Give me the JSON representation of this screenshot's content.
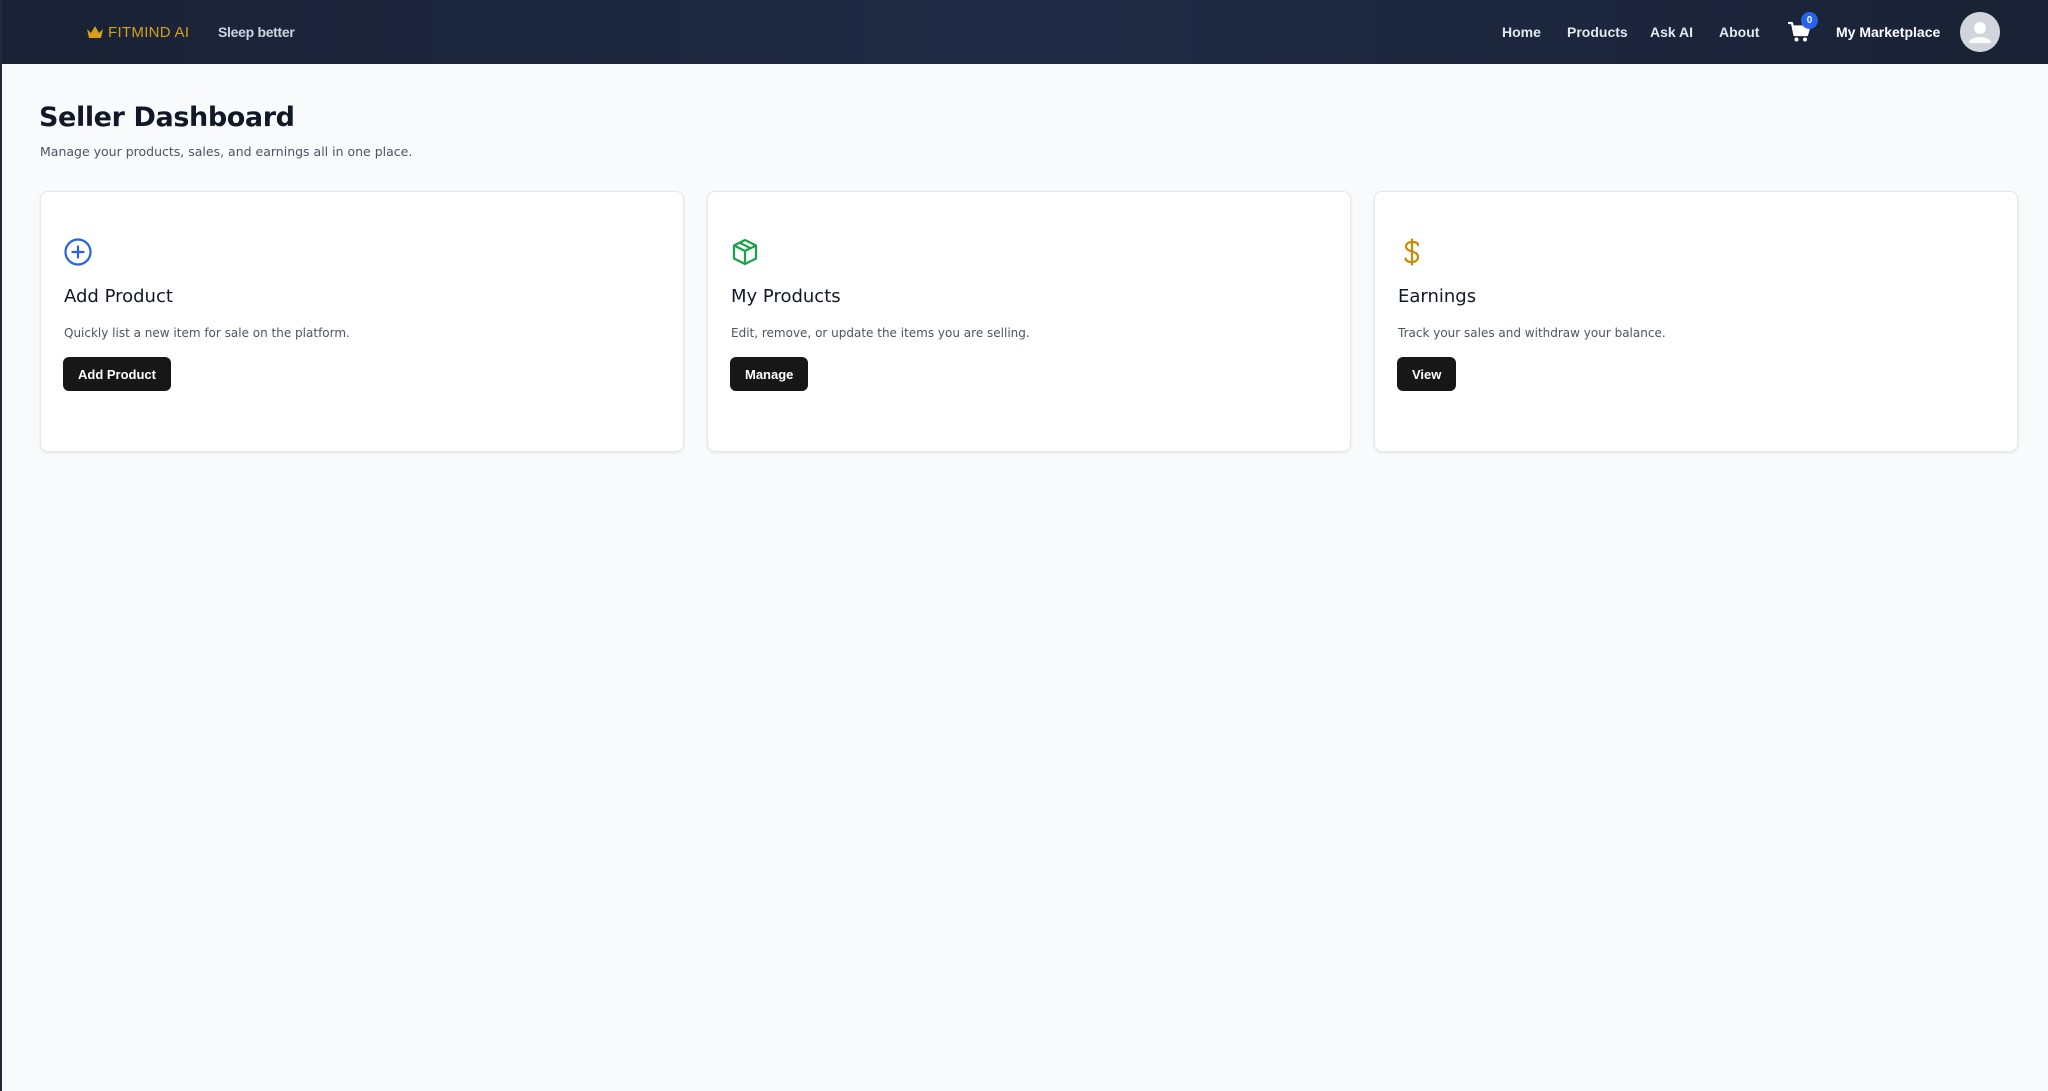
{
  "navbar": {
    "brand_name": "FITMIND AI",
    "brand_icon": "crown-icon",
    "tagline": "Sleep better",
    "links": {
      "home": "Home",
      "products": "Products",
      "ask_ai": "Ask AI",
      "about": "About",
      "marketplace": "My Marketplace"
    },
    "cart_count": "0",
    "cart_icon": "shopping-cart-icon",
    "avatar_icon": "user-avatar-icon"
  },
  "header": {
    "title": "Seller Dashboard",
    "subtitle": "Manage your products, sales, and earnings all in one place."
  },
  "cards": [
    {
      "icon": "plus-circle-icon",
      "icon_color": "#2563eb",
      "title": "Add Product",
      "description": "Quickly list a new item for sale on the platform.",
      "button_label": "Add Product"
    },
    {
      "icon": "package-box-icon",
      "icon_color": "#16a34a",
      "title": "My Products",
      "description": "Edit, remove, or update the items you are selling.",
      "button_label": "Manage"
    },
    {
      "icon": "dollar-sign-icon",
      "icon_color": "#ca8a04",
      "title": "Earnings",
      "description": "Track your sales and withdraw your balance.",
      "button_label": "View"
    }
  ],
  "colors": {
    "navbar_bg": "#1a2235",
    "brand_gold": "#d4a017",
    "button_bg": "#171717",
    "badge_blue": "#2563eb",
    "page_bg": "#f8fafc"
  }
}
